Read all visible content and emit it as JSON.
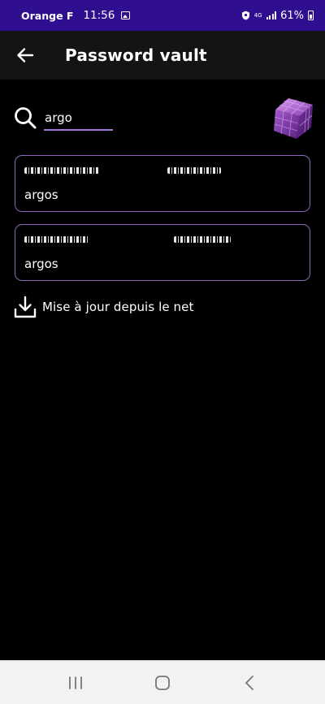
{
  "status_bar": {
    "carrier": "Orange F",
    "time": "11:56",
    "network": "4G",
    "battery": "61%",
    "background": "#2f0f8f"
  },
  "app_bar": {
    "title": "Password vault",
    "back_icon": "arrow-left-icon"
  },
  "search": {
    "value": "argo",
    "placeholder": "",
    "icon": "search-icon",
    "underline_color": "#a27ad4"
  },
  "entries": [
    {
      "name": "argos",
      "login_redacted": true,
      "password_redacted": true
    },
    {
      "name": "argos",
      "login_redacted": true,
      "password_redacted": true
    }
  ],
  "update": {
    "label": "Mise à jour depuis le net",
    "icon": "download-icon"
  },
  "nav_bar": {
    "recent_icon": "recent-apps-icon",
    "home_icon": "home-icon",
    "back_icon": "back-icon"
  },
  "colors": {
    "accent": "#8e68b9",
    "card_border": "#8e68b9",
    "logo": "#8c3fb5"
  }
}
